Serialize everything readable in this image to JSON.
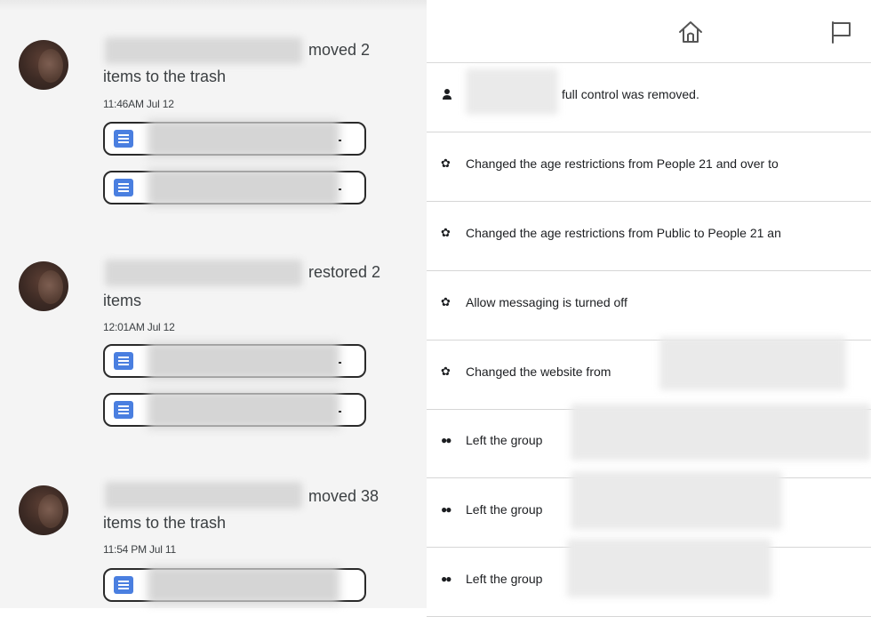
{
  "activity": [
    {
      "action": "moved 2",
      "continuation": "items to the trash",
      "time": "11:46AM Jul 12",
      "file_count": 2
    },
    {
      "action": "restored 2",
      "continuation": "items",
      "time": "12:01AM Jul 12",
      "file_count": 2
    },
    {
      "action": "moved 38",
      "continuation": "items to the trash",
      "time": "11:54 PM Jul 11",
      "file_count": 1
    }
  ],
  "header": {
    "home_icon": "home-icon",
    "flag_icon": "flag-icon"
  },
  "log": [
    {
      "icon": "person-icon",
      "text": "full control was removed."
    },
    {
      "icon": "gear-icon",
      "text": "Changed the age restrictions from People 21 and over to"
    },
    {
      "icon": "gear-icon",
      "text": "Changed the age restrictions from Public to People 21 an"
    },
    {
      "icon": "gear-icon",
      "text": "Allow messaging is turned off"
    },
    {
      "icon": "gear-icon",
      "text": "Changed the website from"
    },
    {
      "icon": "group-icon",
      "text": "Left the group"
    },
    {
      "icon": "group-icon",
      "text": "Left the group"
    },
    {
      "icon": "group-icon",
      "text": "Left the group"
    }
  ]
}
